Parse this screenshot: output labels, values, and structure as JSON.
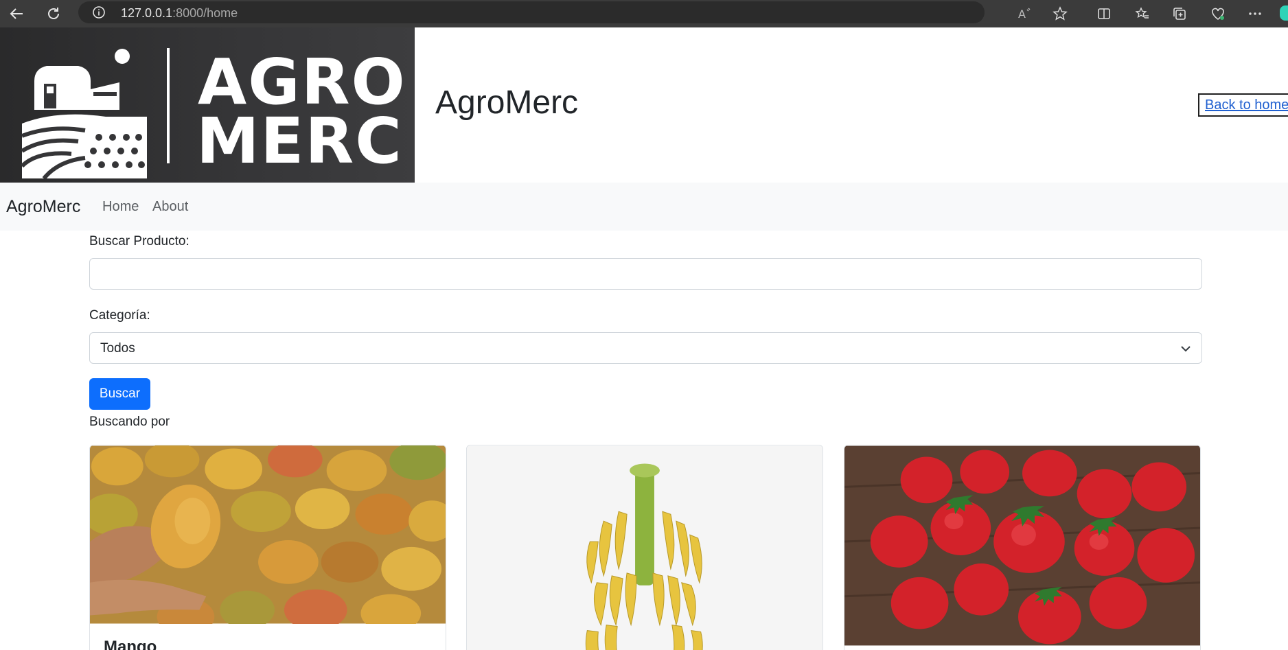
{
  "browser": {
    "url_host": "127.0.0.1",
    "url_path": ":8000/home"
  },
  "header": {
    "logo_line1": "AGRO",
    "logo_line2": "MERC",
    "title": "AgroMerc",
    "back_link": "Back to home"
  },
  "navbar": {
    "brand": "AgroMerc",
    "links": [
      "Home",
      "About"
    ]
  },
  "form": {
    "search_label": "Buscar Producto:",
    "search_value": "",
    "category_label": "Categoría:",
    "category_value": "Todos",
    "submit_label": "Buscar",
    "searching_text": "Buscando por"
  },
  "products": [
    {
      "title": "Mango",
      "image": "mango-photo"
    },
    {
      "title": "",
      "image": "banana-bunch-photo"
    },
    {
      "title": "",
      "image": "strawberries-photo"
    }
  ],
  "colors": {
    "primary": "#0d6efd",
    "navbar_bg": "#f8f9fa",
    "chrome_bg": "#3b3b3b"
  }
}
